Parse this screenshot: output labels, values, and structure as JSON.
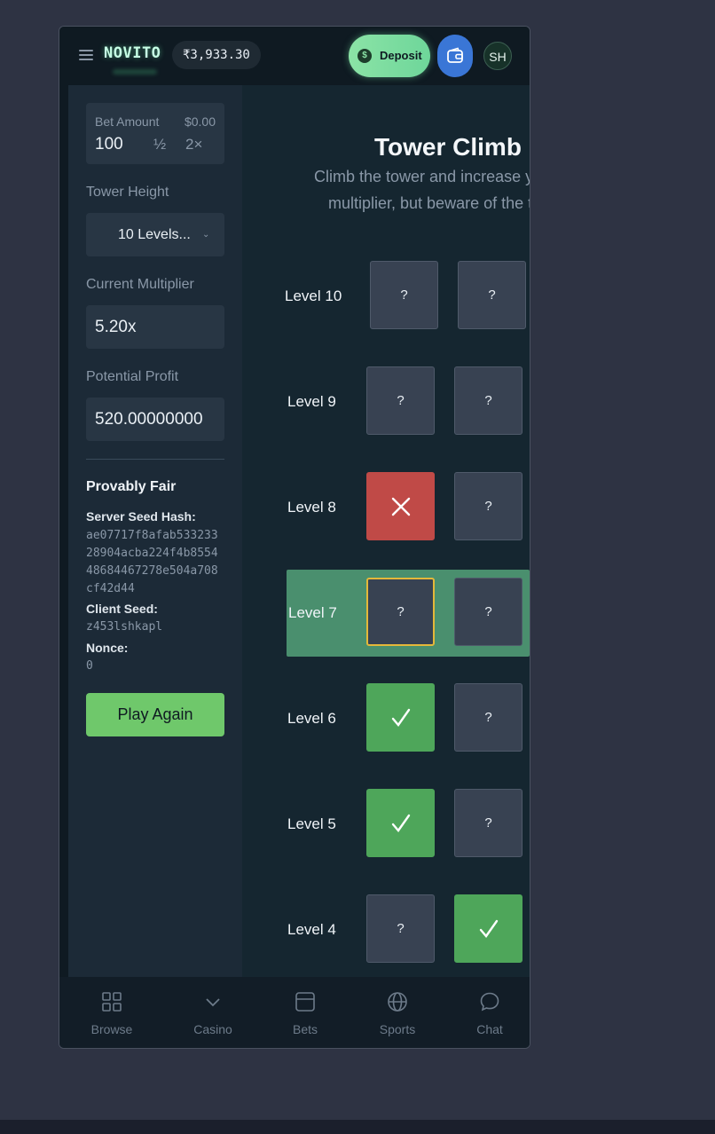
{
  "header": {
    "logo": "NOVITO",
    "balance": "₹3,933.30",
    "deposit_currency": "$",
    "deposit_label": "Deposit",
    "avatar_initials": "SH"
  },
  "sidebar": {
    "bet_amount_label": "Bet Amount",
    "bet_amount_usd": "$0.00",
    "bet_amount_value": "100",
    "half_label": "½",
    "double_label": "2×",
    "tower_height_label": "Tower Height",
    "tower_height_value": "10 Levels...",
    "current_multiplier_label": "Current Multiplier",
    "current_multiplier_value": "5.20x",
    "potential_profit_label": "Potential Profit",
    "potential_profit_value": "520.00000000",
    "provably_fair_title": "Provably Fair",
    "server_seed_hash_label": "Server Seed Hash:",
    "server_seed_hash_value": "ae07717f8afab53323328904acba224f4b855448684467278e504a708cf42d44",
    "client_seed_label": "Client Seed:",
    "client_seed_value": "z453lshkapl",
    "nonce_label": "Nonce:",
    "nonce_value": "0",
    "play_again_label": "Play Again"
  },
  "game": {
    "title": "Tower Climb",
    "subtitle_line1": "Climb the tower and increase your",
    "subtitle_line2": "multiplier, but beware of the traps!",
    "levels": [
      {
        "label": "Level 10",
        "tiles": [
          {
            "state": "hidden",
            "text": "?"
          },
          {
            "state": "hidden",
            "text": "?"
          }
        ]
      },
      {
        "label": "Level 9",
        "tiles": [
          {
            "state": "hidden",
            "text": "?"
          },
          {
            "state": "hidden",
            "text": "?"
          }
        ]
      },
      {
        "label": "Level 8",
        "tiles": [
          {
            "state": "fail",
            "icon": "x-icon"
          },
          {
            "state": "hidden",
            "text": "?"
          }
        ]
      },
      {
        "label": "Level 7",
        "active": true,
        "tiles": [
          {
            "state": "selected",
            "text": "?"
          },
          {
            "state": "hidden",
            "text": "?"
          }
        ]
      },
      {
        "label": "Level 6",
        "tiles": [
          {
            "state": "safe",
            "icon": "check-icon"
          },
          {
            "state": "hidden",
            "text": "?"
          }
        ]
      },
      {
        "label": "Level 5",
        "tiles": [
          {
            "state": "safe",
            "icon": "check-icon"
          },
          {
            "state": "hidden",
            "text": "?"
          }
        ]
      },
      {
        "label": "Level 4",
        "tiles": [
          {
            "state": "hidden",
            "text": "?"
          },
          {
            "state": "safe",
            "icon": "check-icon"
          }
        ]
      }
    ]
  },
  "bottom_nav": {
    "items": [
      {
        "label": "Browse",
        "icon": "grid-icon"
      },
      {
        "label": "Casino",
        "icon": "chevron-down-icon"
      },
      {
        "label": "Bets",
        "icon": "ticket-icon"
      },
      {
        "label": "Sports",
        "icon": "globe-icon"
      },
      {
        "label": "Chat",
        "icon": "chat-bubble-icon"
      }
    ]
  },
  "colors": {
    "accent_green": "#6fc86b",
    "deposit_green": "#8be3a6",
    "fail_red": "#c04a47",
    "active_row": "#4a8f6e",
    "selected_border": "#e5b83a",
    "wallet_blue": "#3a76d6"
  }
}
